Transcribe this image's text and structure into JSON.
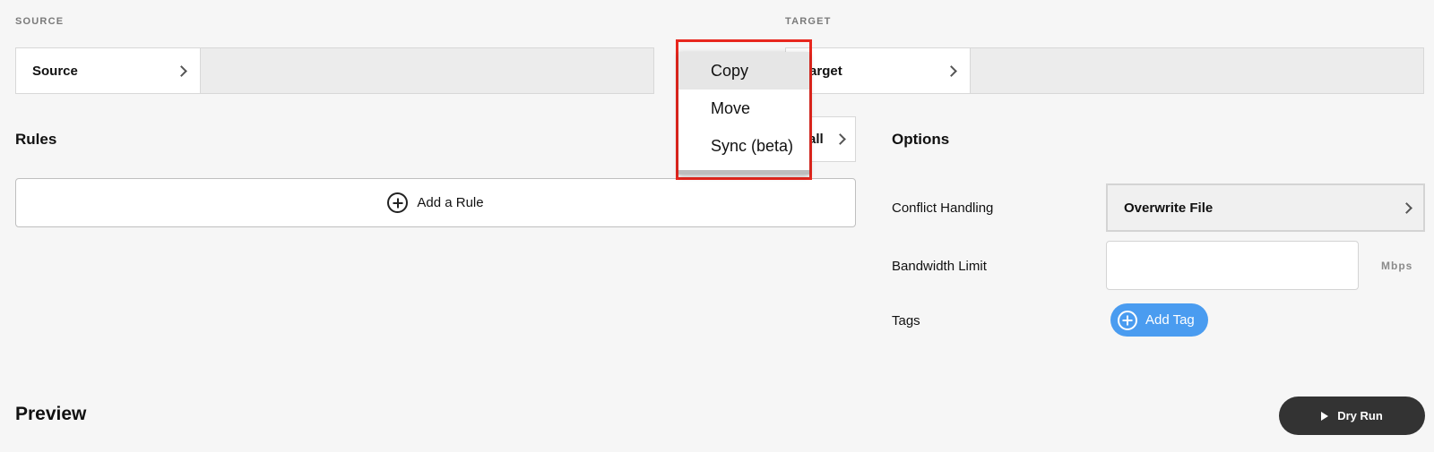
{
  "source": {
    "section_label": "SOURCE",
    "selector_label": "Source"
  },
  "target": {
    "section_label": "TARGET",
    "selector_label": "Target"
  },
  "rules": {
    "heading": "Rules",
    "add_rule_label": "Add a Rule",
    "partial_button_label": "all"
  },
  "menu": {
    "items": [
      {
        "label": "Copy",
        "active": true
      },
      {
        "label": "Move",
        "active": false
      },
      {
        "label": "Sync (beta)",
        "active": false
      }
    ],
    "highlight_color": "#e8271e"
  },
  "options": {
    "heading": "Options",
    "conflict_handling": {
      "label": "Conflict Handling",
      "value": "Overwrite File"
    },
    "bandwidth_limit": {
      "label": "Bandwidth Limit",
      "value": "",
      "unit": "Mbps"
    },
    "tags": {
      "label": "Tags",
      "add_tag_label": "Add Tag"
    }
  },
  "preview": {
    "heading": "Preview"
  },
  "actions": {
    "dry_run_label": "Dry Run"
  },
  "colors": {
    "accent_blue": "#4a9cf0",
    "dark_button": "#333333",
    "background": "#f6f6f6"
  }
}
